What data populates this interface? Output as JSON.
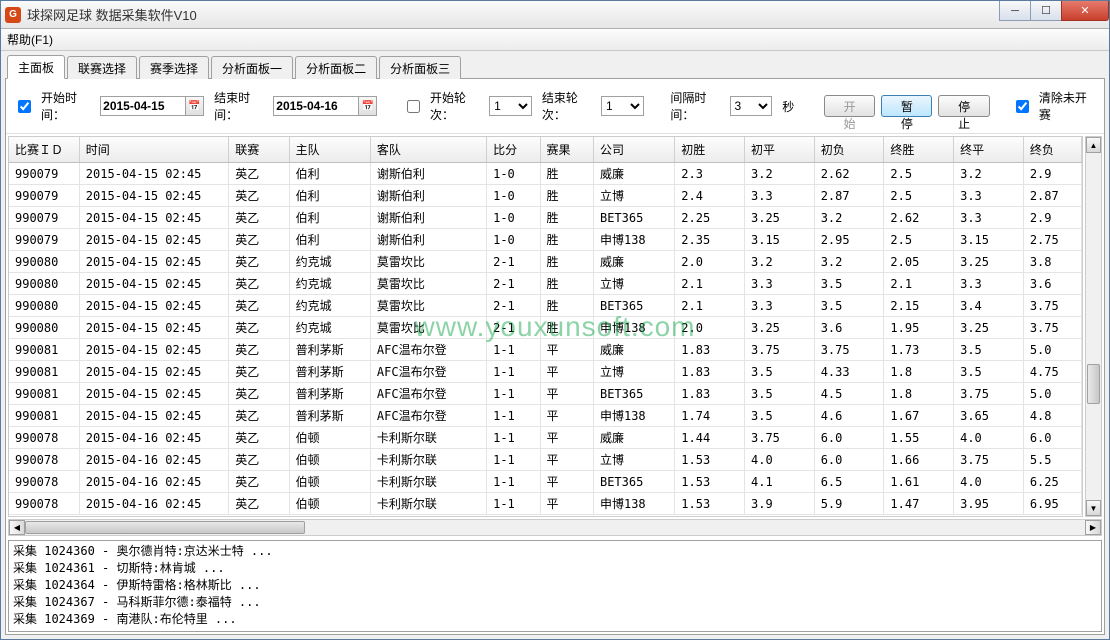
{
  "window": {
    "title": "球探网足球    数据采集软件V10",
    "icon_letter": "G"
  },
  "menu": {
    "help": "帮助(F1)"
  },
  "tabs": [
    {
      "label": "主面板",
      "active": true
    },
    {
      "label": "联赛选择",
      "active": false
    },
    {
      "label": "赛季选择",
      "active": false
    },
    {
      "label": "分析面板一",
      "active": false
    },
    {
      "label": "分析面板二",
      "active": false
    },
    {
      "label": "分析面板三",
      "active": false
    }
  ],
  "toolbar": {
    "start_time_label": "开始时间：",
    "start_time_value": "2015-04-15",
    "end_time_label": "结束时间：",
    "end_time_value": "2015-04-16",
    "start_round_label": "开始轮次：",
    "start_round_value": "1",
    "end_round_label": "结束轮次：",
    "end_round_value": "1",
    "interval_label": "间隔时间：",
    "interval_value": "3",
    "interval_unit": "秒",
    "btn_start": "开始",
    "btn_pause": "暂停",
    "btn_stop": "停止",
    "clear_label": "清除未开赛"
  },
  "columns": [
    "比赛ＩＤ",
    "时间",
    "联赛",
    "主队",
    "客队",
    "比分",
    "赛果",
    "公司",
    "初胜",
    "初平",
    "初负",
    "终胜",
    "终平",
    "终负"
  ],
  "rows": [
    [
      "990079",
      "2015-04-15 02:45",
      "英乙",
      "伯利",
      "谢斯伯利",
      "1-0",
      "胜",
      "威廉",
      "2.3",
      "3.2",
      "2.62",
      "2.5",
      "3.2",
      "2.9"
    ],
    [
      "990079",
      "2015-04-15 02:45",
      "英乙",
      "伯利",
      "谢斯伯利",
      "1-0",
      "胜",
      "立博",
      "2.4",
      "3.3",
      "2.87",
      "2.5",
      "3.3",
      "2.87"
    ],
    [
      "990079",
      "2015-04-15 02:45",
      "英乙",
      "伯利",
      "谢斯伯利",
      "1-0",
      "胜",
      "BET365",
      "2.25",
      "3.25",
      "3.2",
      "2.62",
      "3.3",
      "2.9"
    ],
    [
      "990079",
      "2015-04-15 02:45",
      "英乙",
      "伯利",
      "谢斯伯利",
      "1-0",
      "胜",
      "申博138",
      "2.35",
      "3.15",
      "2.95",
      "2.5",
      "3.15",
      "2.75"
    ],
    [
      "990080",
      "2015-04-15 02:45",
      "英乙",
      "约克城",
      "莫雷坎比",
      "2-1",
      "胜",
      "威廉",
      "2.0",
      "3.2",
      "3.2",
      "2.05",
      "3.25",
      "3.8"
    ],
    [
      "990080",
      "2015-04-15 02:45",
      "英乙",
      "约克城",
      "莫雷坎比",
      "2-1",
      "胜",
      "立博",
      "2.1",
      "3.3",
      "3.5",
      "2.1",
      "3.3",
      "3.6"
    ],
    [
      "990080",
      "2015-04-15 02:45",
      "英乙",
      "约克城",
      "莫雷坎比",
      "2-1",
      "胜",
      "BET365",
      "2.1",
      "3.3",
      "3.5",
      "2.15",
      "3.4",
      "3.75"
    ],
    [
      "990080",
      "2015-04-15 02:45",
      "英乙",
      "约克城",
      "莫雷坎比",
      "2-1",
      "胜",
      "申博138",
      "2.0",
      "3.25",
      "3.6",
      "1.95",
      "3.25",
      "3.75"
    ],
    [
      "990081",
      "2015-04-15 02:45",
      "英乙",
      "普利茅斯",
      "AFC温布尔登",
      "1-1",
      "平",
      "威廉",
      "1.83",
      "3.75",
      "3.75",
      "1.73",
      "3.5",
      "5.0"
    ],
    [
      "990081",
      "2015-04-15 02:45",
      "英乙",
      "普利茅斯",
      "AFC温布尔登",
      "1-1",
      "平",
      "立博",
      "1.83",
      "3.5",
      "4.33",
      "1.8",
      "3.5",
      "4.75"
    ],
    [
      "990081",
      "2015-04-15 02:45",
      "英乙",
      "普利茅斯",
      "AFC温布尔登",
      "1-1",
      "平",
      "BET365",
      "1.83",
      "3.5",
      "4.5",
      "1.8",
      "3.75",
      "5.0"
    ],
    [
      "990081",
      "2015-04-15 02:45",
      "英乙",
      "普利茅斯",
      "AFC温布尔登",
      "1-1",
      "平",
      "申博138",
      "1.74",
      "3.5",
      "4.6",
      "1.67",
      "3.65",
      "4.8"
    ],
    [
      "990078",
      "2015-04-16 02:45",
      "英乙",
      "伯顿",
      "卡利斯尔联",
      "1-1",
      "平",
      "威廉",
      "1.44",
      "3.75",
      "6.0",
      "1.55",
      "4.0",
      "6.0"
    ],
    [
      "990078",
      "2015-04-16 02:45",
      "英乙",
      "伯顿",
      "卡利斯尔联",
      "1-1",
      "平",
      "立博",
      "1.53",
      "4.0",
      "6.0",
      "1.66",
      "3.75",
      "5.5"
    ],
    [
      "990078",
      "2015-04-16 02:45",
      "英乙",
      "伯顿",
      "卡利斯尔联",
      "1-1",
      "平",
      "BET365",
      "1.53",
      "4.1",
      "6.5",
      "1.61",
      "4.0",
      "6.25"
    ],
    [
      "990078",
      "2015-04-16 02:45",
      "英乙",
      "伯顿",
      "卡利斯尔联",
      "1-1",
      "平",
      "申博138",
      "1.53",
      "3.9",
      "5.9",
      "1.47",
      "3.95",
      "6.95"
    ]
  ],
  "log_lines": [
    "采集 1024360 - 奥尔德肖特:京达米士特 ...",
    "采集 1024361 - 切斯特:林肯城 ...",
    "采集 1024364 - 伊斯特雷格:格林斯比 ...",
    "采集 1024367 - 马科斯菲尔德:泰福特 ...",
    "采集 1024369 - 南港队:布伦特里 ..."
  ],
  "watermark": "www.youxunsoft.com"
}
